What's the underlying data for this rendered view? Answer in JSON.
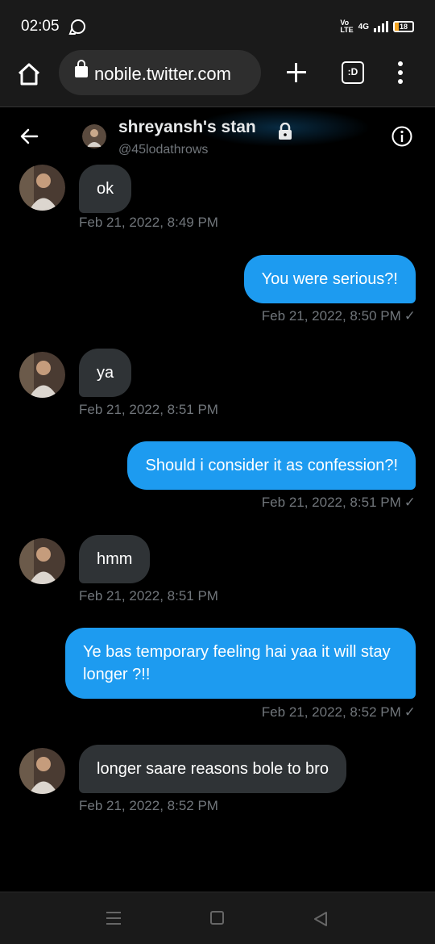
{
  "status_bar": {
    "time": "02:05",
    "volte": "Vo\nLTE",
    "network": "4G",
    "battery": "18"
  },
  "browser": {
    "url": "nobile.twitter.com",
    "tabs_label": ":D"
  },
  "conversation": {
    "name": "shreyansh's stan",
    "handle": "@45lodathrows"
  },
  "messages": [
    {
      "direction": "in",
      "text": "ok",
      "time": "Feb 21, 2022, 8:49 PM"
    },
    {
      "direction": "out",
      "text": "You were serious?!",
      "time": "Feb 21, 2022, 8:50 PM"
    },
    {
      "direction": "in",
      "text": "ya",
      "time": "Feb 21, 2022, 8:51 PM"
    },
    {
      "direction": "out",
      "text": "Should i consider it as confession?!",
      "time": "Feb 21, 2022, 8:51 PM"
    },
    {
      "direction": "in",
      "text": "hmm",
      "time": "Feb 21, 2022, 8:51 PM"
    },
    {
      "direction": "out",
      "text": "Ye bas temporary feeling hai yaa it will stay longer ?!!",
      "time": "Feb 21, 2022, 8:52 PM"
    },
    {
      "direction": "in",
      "text": "longer saare reasons bole to bro",
      "time": "Feb 21, 2022, 8:52 PM"
    }
  ],
  "read_check": "✓",
  "colors": {
    "accent": "#1d9bf0",
    "incoming_bubble": "#2f3336",
    "secondary_text": "#71767b",
    "background": "#000000"
  }
}
